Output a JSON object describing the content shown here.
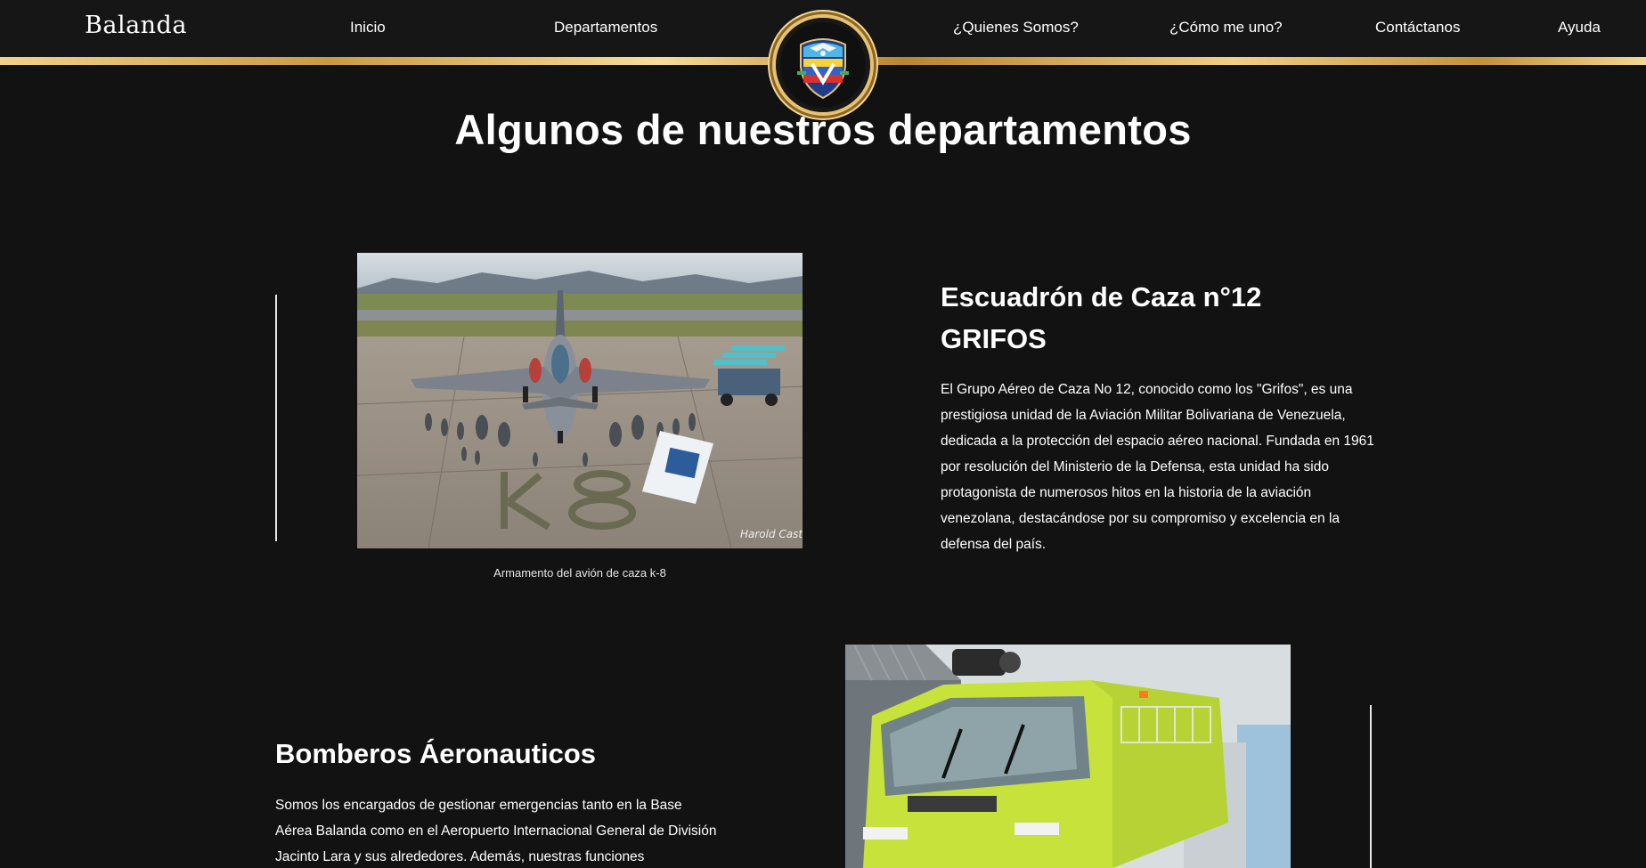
{
  "header": {
    "brand": "Balanda",
    "nav": {
      "inicio": "Inicio",
      "departamentos": "Departamentos",
      "quienes": "¿Quienes Somos?",
      "como": "¿Cómo me uno?",
      "contacto": "Contáctanos",
      "ayuda": "Ayuda"
    }
  },
  "main": {
    "title": "Algunos de nuestros departamentos",
    "departments": [
      {
        "title_line1": "Escuadrón de Caza n°12",
        "title_line2": "GRIFOS",
        "description": "El Grupo Aéreo de Caza No 12, conocido como los \"Grifos\", es una prestigiosa unidad de la Aviación Militar Bolivariana de Venezuela, dedicada a la protección del espacio aéreo nacional. Fundada en 1961 por resolución del Ministerio de la Defensa, esta unidad ha sido protagonista de numerosos hitos en la historia de la aviación venezolana, destacándose por su compromiso y excelencia en la defensa del país.",
        "image_caption": "Armamento del avión de caza k-8",
        "image_watermark": "Harold Castro"
      },
      {
        "title": "Bomberos Áeronauticos",
        "description": "Somos los encargados de gestionar emergencias tanto en la Base Aérea Balanda como en el Aeropuerto Internacional General de División Jacinto Lara y sus alrededores. Además, nuestras funciones"
      }
    ]
  },
  "colors": {
    "background": "#121212",
    "header": "#161616",
    "gold": "#d4a955",
    "text": "#ffffff"
  }
}
